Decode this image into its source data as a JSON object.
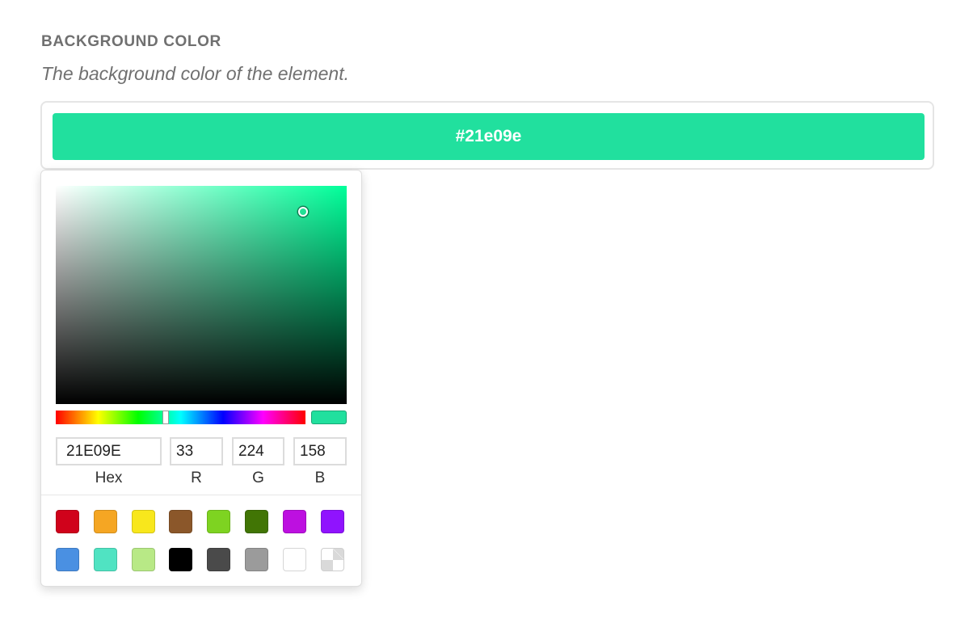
{
  "field": {
    "label": "BACKGROUND COLOR",
    "description": "The background color of the element."
  },
  "current_color": {
    "text": "#21e09e",
    "hex": "#21e09e"
  },
  "picker": {
    "hue_color": "#00ff9a",
    "saturation": 0.85,
    "brightness": 0.88,
    "hue": 159,
    "hex_value": "21E09E",
    "r_value": "33",
    "g_value": "224",
    "b_value": "158",
    "labels": {
      "hex": "Hex",
      "r": "R",
      "g": "G",
      "b": "B"
    },
    "presets": [
      {
        "name": "red",
        "color": "#d0021b"
      },
      {
        "name": "orange",
        "color": "#f5a623"
      },
      {
        "name": "yellow",
        "color": "#f8e71c"
      },
      {
        "name": "brown",
        "color": "#8b572a"
      },
      {
        "name": "lime",
        "color": "#7ed321"
      },
      {
        "name": "dark-green",
        "color": "#417505"
      },
      {
        "name": "magenta",
        "color": "#bd10e0"
      },
      {
        "name": "purple",
        "color": "#9013fe"
      },
      {
        "name": "blue",
        "color": "#4a90e2"
      },
      {
        "name": "teal",
        "color": "#50e3c2"
      },
      {
        "name": "light-green",
        "color": "#b8e986"
      },
      {
        "name": "black",
        "color": "#000000"
      },
      {
        "name": "dark-gray",
        "color": "#4a4a4a"
      },
      {
        "name": "gray",
        "color": "#9b9b9b"
      },
      {
        "name": "white",
        "color": "#ffffff"
      },
      {
        "name": "transparent",
        "color": "transparent"
      }
    ]
  }
}
